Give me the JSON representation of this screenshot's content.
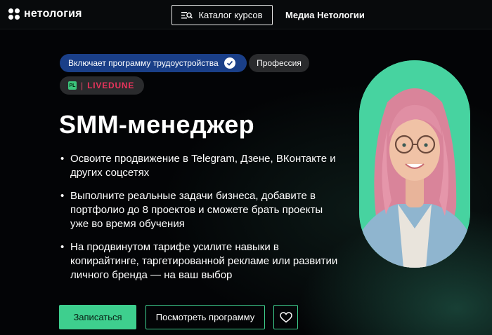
{
  "header": {
    "logo_text": "нетология",
    "catalog_label": "Каталог курсов",
    "media_label": "Медиа Нетологии"
  },
  "badges": {
    "employment": "Включает программу трудоустройства",
    "profession": "Профессия",
    "partner_sep": "|",
    "partner_name": "LIVEDUNE",
    "partner_icon_text": "PL"
  },
  "title": "SMM-менеджер",
  "bullets": [
    "Освоите продвижение в Telegram, Дзене, ВКонтакте и других соцсетях",
    "Выполните реальные задачи бизнеса, добавите в портфолио до 8 проектов и сможете брать проекты уже во время обучения",
    "На продвинутом тарифе усилите навыки в копирайтинге, таргетированной рекламе или развитии личного бренда — на ваш выбор"
  ],
  "actions": {
    "enroll_label": "Записаться",
    "program_label": "Посмотреть программу"
  },
  "icons": {
    "logo": "logo-icon",
    "catalog": "catalog-list-icon",
    "verified": "verified-check-icon",
    "favorite": "heart-icon"
  },
  "colors": {
    "accent": "#3ecf8e",
    "badge_blue": "#1a3f88",
    "partner_red": "#e8345c",
    "hero_bg": "#47d3a0"
  }
}
